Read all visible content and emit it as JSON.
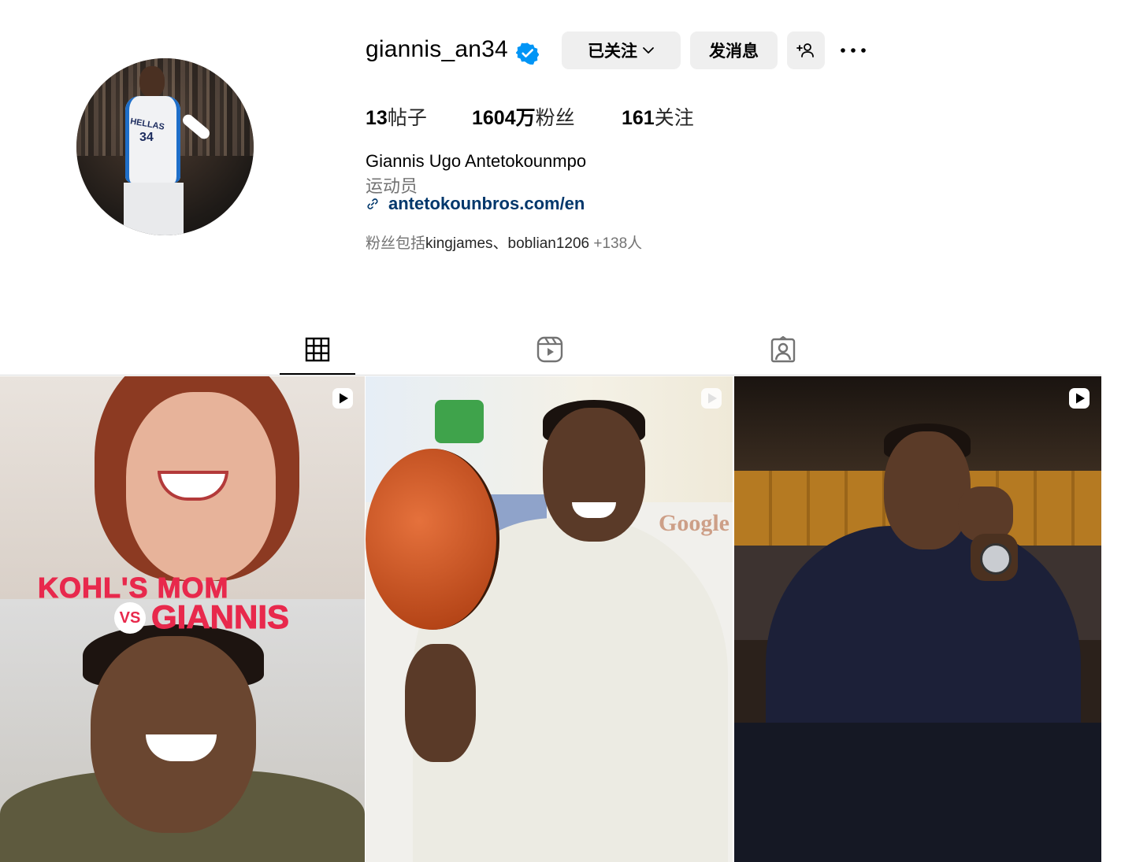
{
  "profile": {
    "username": "giannis_an34",
    "verified_icon": "verified-badge-icon",
    "following_button_label": "已关注",
    "message_button_label": "发消息",
    "adduser_icon": "person-add-icon",
    "more_icon": "more-options-icon"
  },
  "stats": {
    "posts_count": "13",
    "posts_label": "帖子",
    "followers_count": "1604万",
    "followers_label": "粉丝",
    "following_count": "161",
    "following_label": "关注"
  },
  "bio": {
    "full_name": "Giannis Ugo Antetokounmpo",
    "category": "运动员",
    "link_text": "antetokounbros.com/en",
    "followed_by_prefix": "粉丝包括",
    "followed_by_names": "kingjames、boblian1206",
    "followed_by_more": " +138人"
  },
  "tabs": [
    {
      "icon": "grid-icon",
      "active": true
    },
    {
      "icon": "reels-icon",
      "active": false
    },
    {
      "icon": "tagged-icon",
      "active": false
    }
  ],
  "posts": [
    {
      "type": "reel",
      "overlay_text_1": "KOHL'S MOM",
      "overlay_vs": "VS",
      "overlay_text_2": "GIANNIS"
    },
    {
      "type": "reel"
    },
    {
      "type": "reel"
    }
  ],
  "colors": {
    "link": "#00376b",
    "verified": "#0095f6",
    "overlay_red": "#e8294c",
    "button_bg": "#efefef"
  }
}
